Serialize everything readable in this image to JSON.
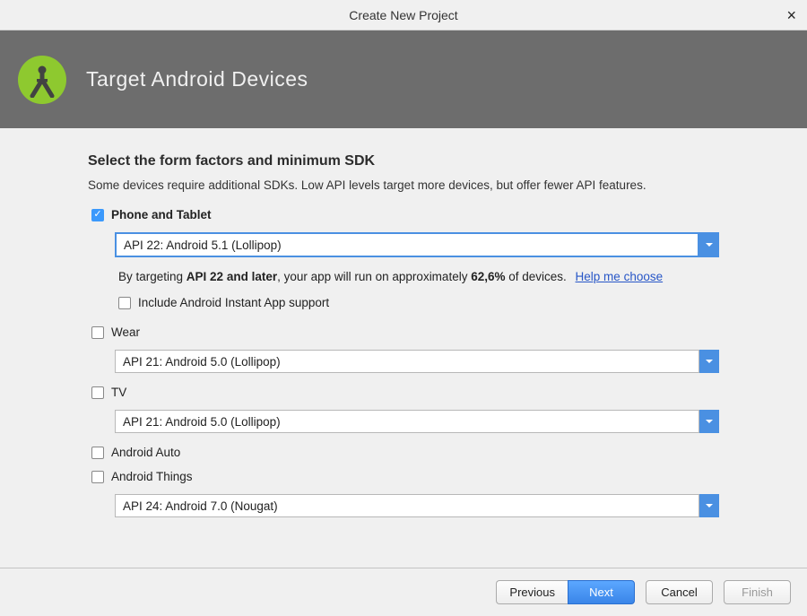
{
  "window": {
    "title": "Create New Project"
  },
  "header": {
    "title": "Target Android Devices"
  },
  "section": {
    "title": "Select the form factors and minimum SDK",
    "description": "Some devices require additional SDKs. Low API levels target more devices, but offer fewer API features."
  },
  "form_factors": {
    "phone_tablet": {
      "label": "Phone and Tablet",
      "checked": true,
      "api": "API 22: Android 5.1 (Lollipop)",
      "hint_prefix": "By targeting ",
      "hint_bold1": "API 22 and later",
      "hint_mid": ", your app will run on approximately ",
      "hint_bold2": "62,6%",
      "hint_suffix": " of devices.",
      "help_link": "Help me choose",
      "instant_label": "Include Android Instant App support",
      "instant_checked": false
    },
    "wear": {
      "label": "Wear",
      "checked": false,
      "api": "API 21: Android 5.0 (Lollipop)"
    },
    "tv": {
      "label": "TV",
      "checked": false,
      "api": "API 21: Android 5.0 (Lollipop)"
    },
    "auto": {
      "label": "Android Auto",
      "checked": false
    },
    "things": {
      "label": "Android Things",
      "checked": false,
      "api": "API 24: Android 7.0 (Nougat)"
    }
  },
  "footer": {
    "previous": "Previous",
    "next": "Next",
    "cancel": "Cancel",
    "finish": "Finish"
  }
}
